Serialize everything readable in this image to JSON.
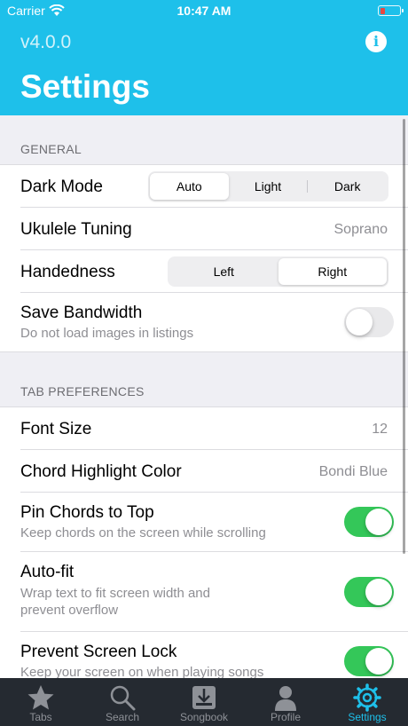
{
  "status_bar": {
    "carrier": "Carrier",
    "time": "10:47 AM"
  },
  "header": {
    "version": "v4.0.0",
    "title": "Settings",
    "info_icon": "info-icon"
  },
  "general": {
    "section_title": "GENERAL",
    "dark_mode": {
      "label": "Dark Mode",
      "options": [
        "Auto",
        "Light",
        "Dark"
      ],
      "selected": "Auto"
    },
    "ukulele_tuning": {
      "label": "Ukulele Tuning",
      "value": "Soprano"
    },
    "handedness": {
      "label": "Handedness",
      "options": [
        "Left",
        "Right"
      ],
      "selected": "Right"
    },
    "save_bandwidth": {
      "label": "Save Bandwidth",
      "subtitle": "Do not load images in listings",
      "enabled": false
    }
  },
  "tab_preferences": {
    "section_title": "TAB PREFERENCES",
    "font_size": {
      "label": "Font Size",
      "value": "12"
    },
    "chord_highlight_color": {
      "label": "Chord Highlight Color",
      "value": "Bondi Blue"
    },
    "pin_chords": {
      "label": "Pin Chords to Top",
      "subtitle": "Keep chords on the screen while scrolling",
      "enabled": true
    },
    "auto_fit": {
      "label": "Auto-fit",
      "subtitle_line1": "Wrap text to fit screen width and",
      "subtitle_line2": "prevent overflow",
      "enabled": true
    },
    "prevent_screen_lock": {
      "label": "Prevent Screen Lock",
      "subtitle": "Keep your screen on when playing songs",
      "enabled": true
    }
  },
  "tab_bar": {
    "tabs": [
      {
        "label": "Tabs",
        "icon": "star-icon"
      },
      {
        "label": "Search",
        "icon": "search-icon"
      },
      {
        "label": "Songbook",
        "icon": "download-icon"
      },
      {
        "label": "Profile",
        "icon": "person-icon"
      },
      {
        "label": "Settings",
        "icon": "gear-icon"
      }
    ],
    "active": "Settings"
  },
  "colors": {
    "accent": "#1ec0ea",
    "toggle_on": "#34c759",
    "tab_bar": "#252a31"
  }
}
